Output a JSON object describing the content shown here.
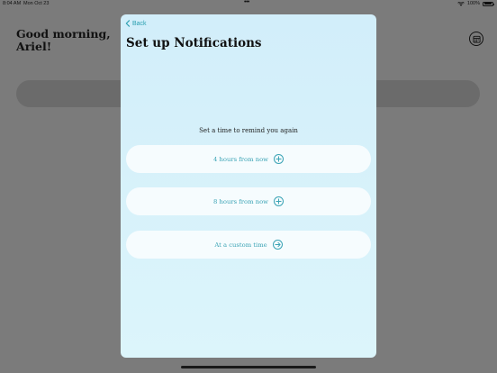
{
  "status_bar": {
    "time": "8:04 AM",
    "date": "Mon Oct 23",
    "dots": "•••",
    "battery": "100%"
  },
  "background": {
    "greeting": "Good morning, Ariel!"
  },
  "sheet": {
    "back_label": "Back",
    "title": "Set up Notifications",
    "reminder_prompt": "Set a time to remind you again",
    "options": [
      {
        "label": "4 hours from now",
        "icon": "plus-circle-icon"
      },
      {
        "label": "8 hours from now",
        "icon": "plus-circle-icon"
      },
      {
        "label": "At a custom time",
        "icon": "arrow-right-circle-icon"
      }
    ]
  },
  "colors": {
    "accent": "#3aa3b5",
    "sheet_bg": "#d6f1fa",
    "dim_bg": "#7b7b7b"
  }
}
